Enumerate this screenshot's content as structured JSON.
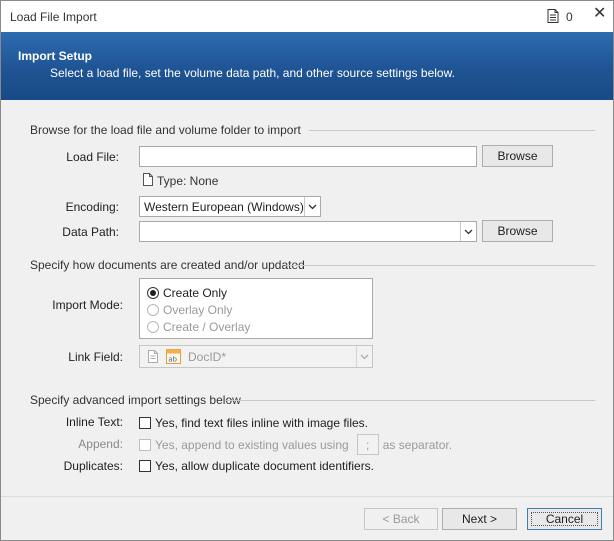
{
  "window": {
    "title": "Load File Import",
    "notification_count": "0",
    "close_glyph": "✕"
  },
  "banner": {
    "title": "Import Setup",
    "subtitle": "Select a load file, set the volume data path, and other source settings below."
  },
  "browse_section": {
    "heading": "Browse for the load file and volume folder to import",
    "load_file_label": "Load File:",
    "load_file_value": "",
    "browse_label": "Browse",
    "type_text": "Type: None",
    "encoding_label": "Encoding:",
    "encoding_value": "Western European (Windows)",
    "data_path_label": "Data Path:",
    "data_path_value": "",
    "browse2_label": "Browse"
  },
  "create_section": {
    "heading": "Specify how documents are created and/or updated",
    "import_mode_label": "Import Mode:",
    "modes": [
      {
        "label": "Create Only",
        "checked": true,
        "enabled": true
      },
      {
        "label": "Overlay Only",
        "checked": false,
        "enabled": false
      },
      {
        "label": "Create / Overlay",
        "checked": false,
        "enabled": false
      }
    ],
    "link_field_label": "Link Field:",
    "link_field_value": "DocID*"
  },
  "advanced_section": {
    "heading": "Specify advanced import settings below",
    "inline_label": "Inline Text:",
    "inline_text": "Yes, find text files inline with image files.",
    "append_label": "Append:",
    "append_text": "Yes, append to existing values using",
    "separator_value": ";",
    "append_suffix": "as separator.",
    "duplicates_label": "Duplicates:",
    "duplicates_text": "Yes, allow duplicate document identifiers."
  },
  "footer": {
    "back_label": "< Back",
    "next_label": "Next >",
    "cancel_label": "Cancel"
  },
  "icons": {
    "title_doc": "document-icon",
    "close": "close-icon",
    "dropdown": "chevron-down-icon",
    "link_field_doc": "document-icon",
    "link_field_type": "text-field-icon"
  },
  "colors": {
    "banner_top": "#2d6cb0",
    "banner_bottom": "#174a86",
    "focus_border": "#3c7fb1"
  }
}
